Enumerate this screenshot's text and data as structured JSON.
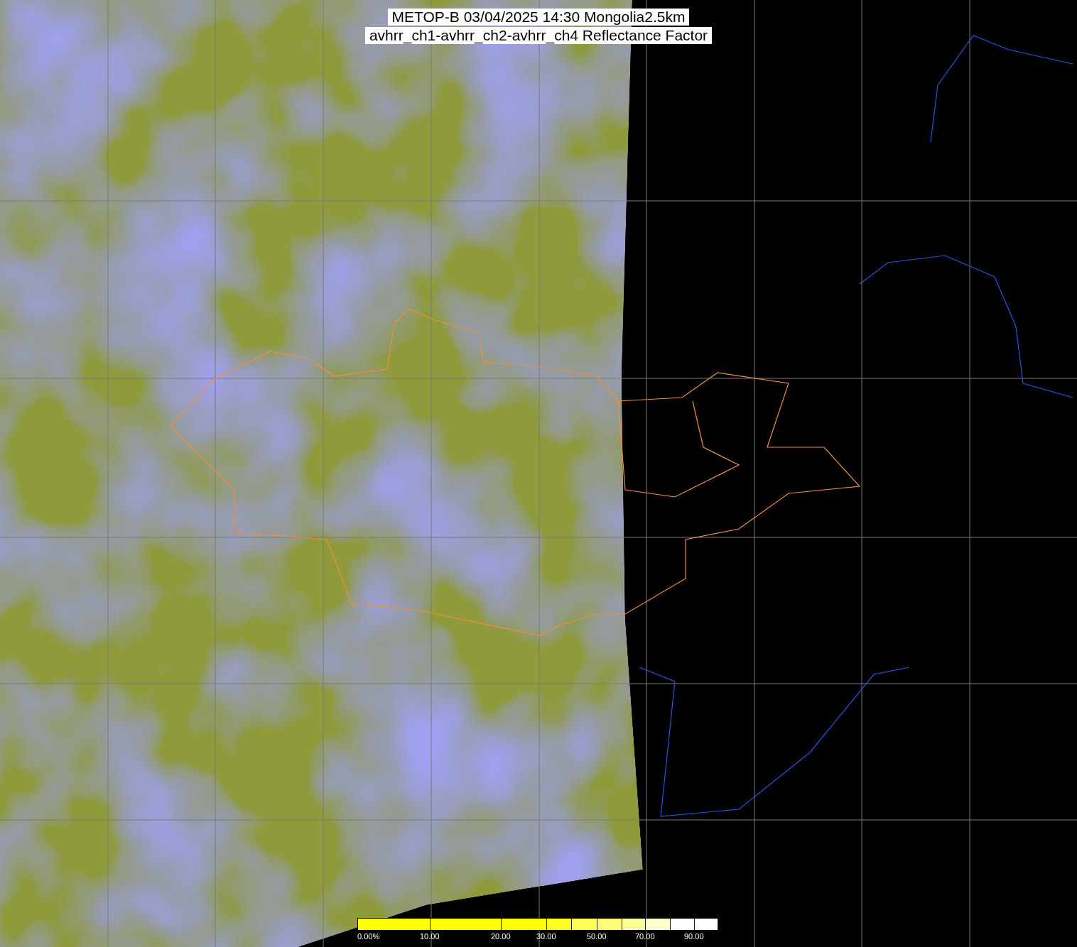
{
  "title": {
    "lines": [
      "METOP-B 03/04/2025 14:30 Mongolia2.5km",
      "avhrr_ch1-avhrr_ch2-avhrr_ch4 Reflectance Factor"
    ]
  },
  "colorbar": {
    "segments": [
      {
        "color": "#ffff00",
        "label": "0.00%"
      },
      {
        "color": "#ffff00",
        "label": "10.00"
      },
      {
        "color": "#ffff00",
        "label": "20.00"
      },
      {
        "color": "#ffff22",
        "label": "30.00"
      },
      {
        "color": "#ffff55"
      },
      {
        "color": "#ffff77",
        "label": "50.00"
      },
      {
        "color": "#ffff99"
      },
      {
        "color": "#ffffcc",
        "label": "70.00"
      },
      {
        "color": "#ffffff"
      },
      {
        "color": "#ffffff",
        "label": "90.00"
      }
    ]
  }
}
